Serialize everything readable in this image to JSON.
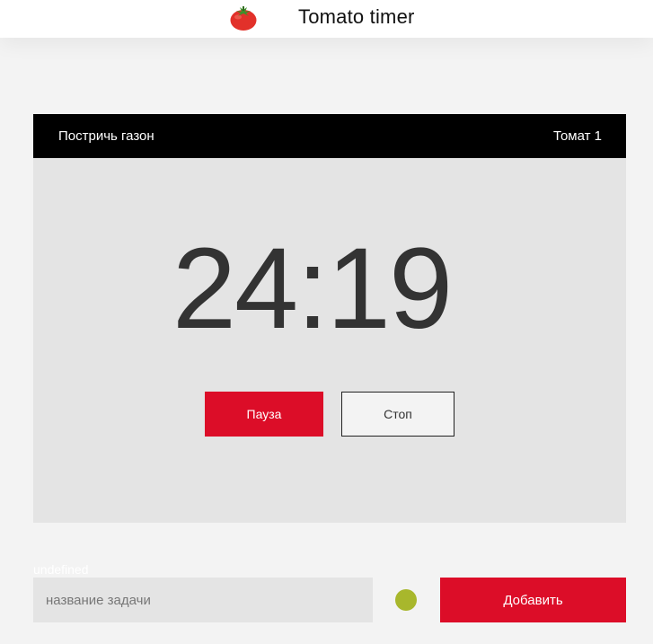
{
  "header": {
    "title": "Tomato timer",
    "logo_icon": "tomato-icon"
  },
  "timer": {
    "task_name": "Постричь газон",
    "tomato_label": "Томат 1",
    "time": "24:19",
    "pause_label": "Пауза",
    "stop_label": "Стоп"
  },
  "form": {
    "label": "undefined",
    "input_placeholder": "название задачи",
    "input_value": "",
    "add_label": "Добавить"
  },
  "colors": {
    "accent": "#dc0d28",
    "status_dot": "#a8b72c",
    "card_bg": "#e4e4e4",
    "card_header_bg": "#000000"
  }
}
